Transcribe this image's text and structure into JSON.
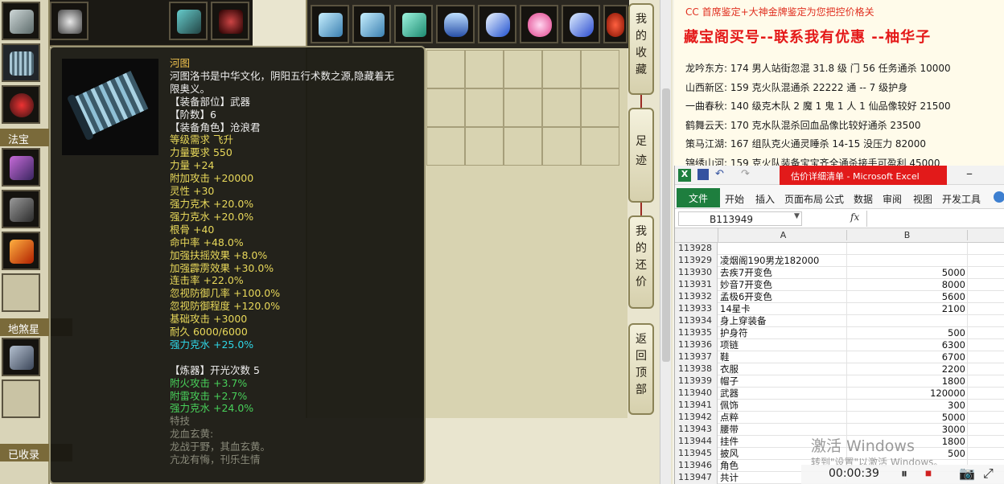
{
  "game": {
    "sections": {
      "fabao": "法宝",
      "disha": "地煞星",
      "collected": "已收录"
    },
    "menu": {
      "favorites": [
        "我",
        "的",
        "收",
        "藏"
      ],
      "footprint": [
        "足",
        "迹"
      ],
      "counter_offer": [
        "我",
        "的",
        "还",
        "价"
      ],
      "back_to_top": [
        "返",
        "回",
        "顶",
        "部"
      ]
    },
    "tooltip": {
      "name": "河图",
      "lines": [
        {
          "t": "河图洛书是中华文化，阴阳五行术数之源,隐藏着无",
          "c": "white"
        },
        {
          "t": "限奥义。",
          "c": "white"
        },
        {
          "t": "【装备部位】武器",
          "c": "white"
        },
        {
          "t": "【阶数】6",
          "c": "white"
        },
        {
          "t": "【装备角色】沧浪君",
          "c": "white"
        },
        {
          "t": "等级需求 飞升",
          "c": "yellow"
        },
        {
          "t": "力量要求 550",
          "c": "yellow"
        },
        {
          "t": "力量 +24",
          "c": "yellow"
        },
        {
          "t": "附加攻击 +20000",
          "c": "yellow"
        },
        {
          "t": "灵性 +30",
          "c": "yellow"
        },
        {
          "t": "强力克木 +20.0%",
          "c": "yellow"
        },
        {
          "t": "强力克水 +20.0%",
          "c": "yellow"
        },
        {
          "t": "根骨 +40",
          "c": "yellow"
        },
        {
          "t": "命中率 +48.0%",
          "c": "yellow"
        },
        {
          "t": "加强扶摇效果 +8.0%",
          "c": "yellow"
        },
        {
          "t": "加强霹雳效果 +30.0%",
          "c": "yellow"
        },
        {
          "t": "连击率 +22.0%",
          "c": "yellow"
        },
        {
          "t": "忽视防御几率 +100.0%",
          "c": "yellow"
        },
        {
          "t": "忽视防御程度 +120.0%",
          "c": "yellow"
        },
        {
          "t": "基础攻击 +3000",
          "c": "yellow"
        },
        {
          "t": "耐久 6000/6000",
          "c": "yellow"
        },
        {
          "t": "强力克水 +25.0%",
          "c": "cyan"
        },
        {
          "t": "",
          "c": "white"
        },
        {
          "t": "【炼器】开光次数 5",
          "c": "mixed"
        },
        {
          "t": "附火攻击 +3.7%",
          "c": "green"
        },
        {
          "t": "附雷攻击 +2.7%",
          "c": "green"
        },
        {
          "t": "强力克水 +24.0%",
          "c": "green"
        },
        {
          "t": "特技",
          "c": "gray"
        },
        {
          "t": "龙血玄黄:",
          "c": "gray"
        },
        {
          "t": "龙战于野，其血玄黄。",
          "c": "gray"
        },
        {
          "t": "亢龙有悔，刊乐生情",
          "c": "gray"
        }
      ]
    }
  },
  "notice": {
    "header": "CC 首席鉴定+大神金牌鉴定为您把控价格关",
    "title": "藏宝阁买号--联系我有优惠 --柚华子",
    "items": [
      "龙吟东方: 174 男人站街忽混 31.8 级 门 56 任务通杀 10000",
      "山西新区: 159 克火队混通杀 22222 通 -- 7 级护身",
      "一曲春秋: 140 级克木队 2 魔 1 鬼 1 人 1 仙品像较好 21500",
      "鹤舞云天: 170 克水队混杀回血品像比较好通杀 23500",
      "策马江湖: 167 组队克火通灵睡杀 14-15 没压力 82000",
      "锦绣山河: 159 克火队装备宝宝齐全通杀接手可盈利 45000"
    ]
  },
  "excel": {
    "window_title": "估价详细清单 - Microsoft Excel",
    "file_tab": "文件",
    "tabs": [
      "开始",
      "插入",
      "页面布局",
      "公式",
      "数据",
      "审阅",
      "视图",
      "开发工具"
    ],
    "name_box": "B113949",
    "fx": "fx",
    "col_a": "A",
    "col_b": "B",
    "rows": [
      {
        "n": "113928",
        "a": "",
        "b": ""
      },
      {
        "n": "113929",
        "a": "凌烟阁190男龙182000",
        "b": ""
      },
      {
        "n": "113930",
        "a": "去疾7开变色",
        "b": "5000"
      },
      {
        "n": "113931",
        "a": "妙音7开变色",
        "b": "8000"
      },
      {
        "n": "113932",
        "a": "孟极6开变色",
        "b": "5600"
      },
      {
        "n": "113933",
        "a": "14星卡",
        "b": "2100"
      },
      {
        "n": "113934",
        "a": "身上穿装备",
        "b": ""
      },
      {
        "n": "113935",
        "a": "护身符",
        "b": "500"
      },
      {
        "n": "113936",
        "a": "项链",
        "b": "6300"
      },
      {
        "n": "113937",
        "a": "鞋",
        "b": "6700"
      },
      {
        "n": "113938",
        "a": "衣服",
        "b": "2200"
      },
      {
        "n": "113939",
        "a": "帽子",
        "b": "1800"
      },
      {
        "n": "113940",
        "a": "武器",
        "b": "120000"
      },
      {
        "n": "113941",
        "a": "佩饰",
        "b": "300"
      },
      {
        "n": "113942",
        "a": "点粹",
        "b": "5000"
      },
      {
        "n": "113943",
        "a": "腰带",
        "b": "3000"
      },
      {
        "n": "113944",
        "a": "挂件",
        "b": "1800"
      },
      {
        "n": "113945",
        "a": "披风",
        "b": "500"
      },
      {
        "n": "113946",
        "a": "角色",
        "b": ""
      },
      {
        "n": "113947",
        "a": "共计",
        "b": ""
      }
    ]
  },
  "overlay": {
    "activate": "激活 Windows",
    "activate_hint": "转到\"设置\"以激活 Windows。",
    "timer": "00:00:39"
  }
}
